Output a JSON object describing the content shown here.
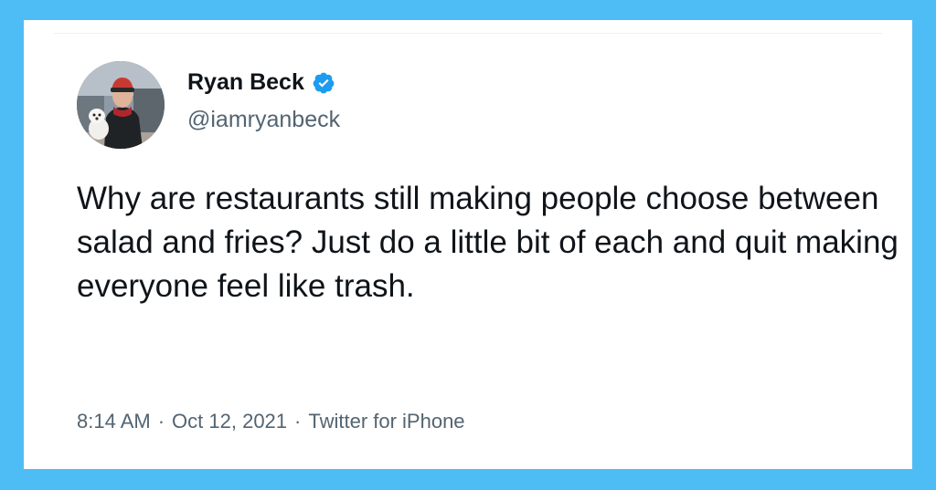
{
  "colors": {
    "frame": "#4ebdf5",
    "card": "#ffffff",
    "text_primary": "#0f1419",
    "text_secondary": "#536471",
    "verified_badge": "#1d9bf0"
  },
  "tweet": {
    "author": {
      "display_name": "Ryan Beck",
      "handle": "@iamryanbeck",
      "verified": true,
      "avatar_icon": "profile-photo-person-with-dog"
    },
    "text": "Why are restaurants still making people choose between salad and fries? Just do a little bit of each and quit making everyone feel like trash.",
    "meta": {
      "time": "8:14 AM",
      "date": "Oct 12, 2021",
      "source": "Twitter for iPhone",
      "separator": "·"
    }
  }
}
